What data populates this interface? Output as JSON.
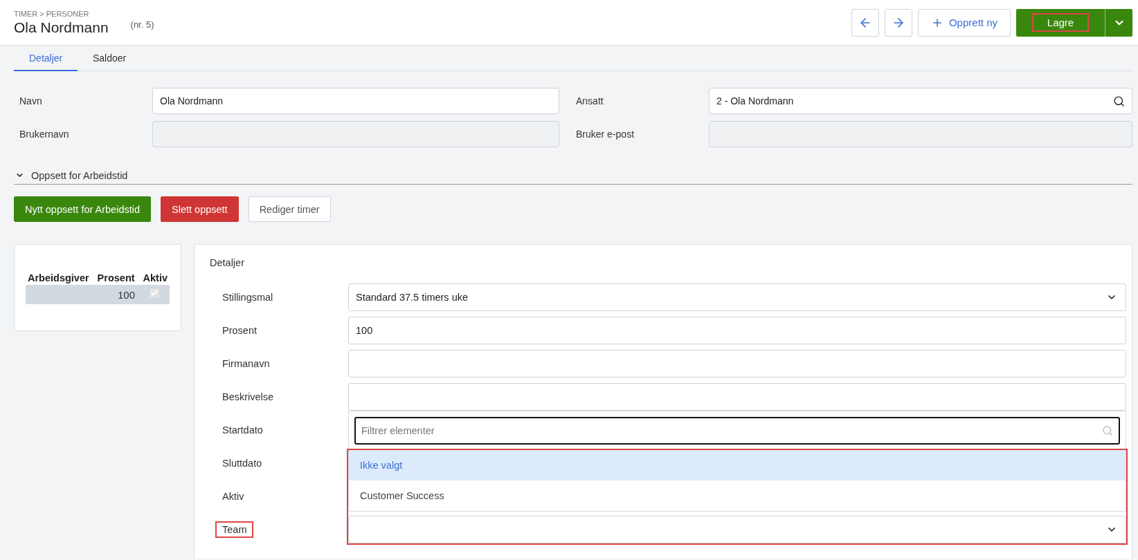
{
  "breadcrumb": "TIMER > PERSONER",
  "title": "Ola Nordmann",
  "record_number": "(nr. 5)",
  "actions": [
    {
      "kind": "back"
    },
    {
      "kind": "forward"
    },
    {
      "kind": "create",
      "label": "Opprett ny"
    },
    {
      "kind": "save",
      "label": "Lagre",
      "highlighted": true
    }
  ],
  "tabs": [
    {
      "label": "Detaljer",
      "selected": true
    },
    {
      "label": "Saldoer",
      "selected": false
    }
  ],
  "person_fields": [
    {
      "label": "Navn",
      "value": "Ola Nordmann",
      "kind": "input"
    },
    {
      "label": "Ansatt",
      "value": "2 - Ola Nordmann",
      "kind": "search"
    },
    {
      "label": "Brukernavn",
      "kind": "disabled"
    },
    {
      "label": "Bruker e-post",
      "kind": "disabled"
    }
  ],
  "section": {
    "title": "Oppsett for Arbeidstid",
    "expanded": true
  },
  "section_buttons": [
    {
      "label": "Nytt oppsett for Arbeidstid",
      "kind": "primary"
    },
    {
      "label": "Slett oppsett",
      "kind": "danger"
    },
    {
      "label": "Rediger timer",
      "kind": "default"
    }
  ],
  "assignments": {
    "columns": [
      "Arbeidsgiver",
      "Prosent",
      "Aktiv"
    ],
    "rows": [
      {
        "employer": "",
        "percent": "100",
        "active": true,
        "selected": true
      }
    ]
  },
  "details": {
    "title": "Detaljer",
    "fields": [
      {
        "label": "Stillingsmal",
        "kind": "select",
        "value": "Standard 37.5 timers uke"
      },
      {
        "label": "Prosent",
        "kind": "input",
        "value": "100"
      },
      {
        "label": "Firmanavn",
        "kind": "input"
      },
      {
        "label": "Beskrivelse",
        "kind": "input"
      },
      {
        "label": "Startdato",
        "kind": "covered"
      },
      {
        "label": "Sluttdato",
        "kind": "covered"
      },
      {
        "label": "Aktiv",
        "kind": "covered"
      },
      {
        "label": "Team",
        "kind": "dropdown",
        "highlighted": true
      }
    ],
    "team_dropdown": {
      "filter_placeholder": "Filtrer elementer",
      "highlighted": true,
      "options": [
        {
          "label": "Ikke valgt",
          "selected": true
        },
        {
          "label": "Customer Success",
          "selected": false
        }
      ]
    }
  }
}
